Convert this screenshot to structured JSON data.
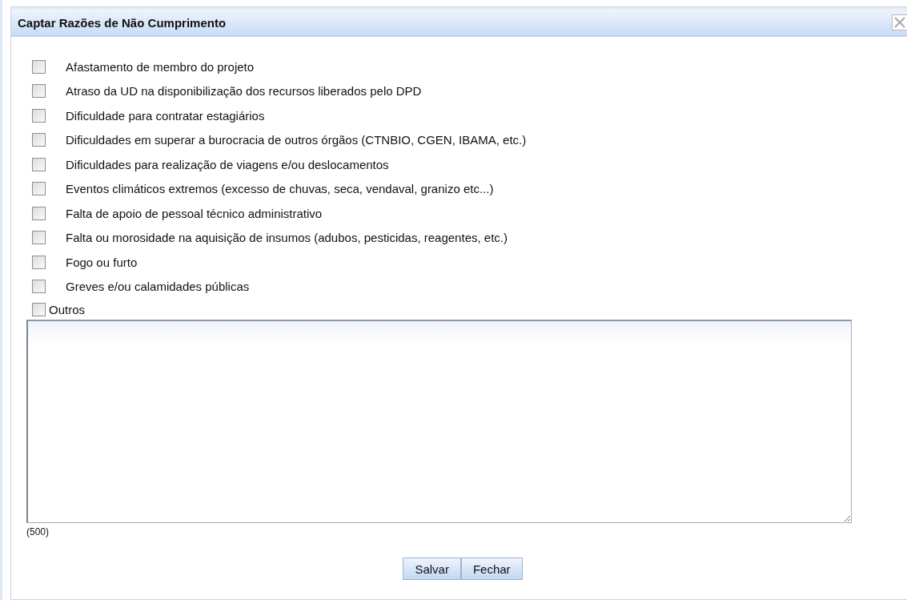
{
  "dialog": {
    "title": "Captar Razões de Não Cumprimento"
  },
  "reasons": [
    {
      "label": "Afastamento de membro do projeto",
      "checked": false
    },
    {
      "label": "Atraso da UD na disponibilização dos recursos liberados pelo DPD",
      "checked": false
    },
    {
      "label": "Dificuldade para contratar estagiários",
      "checked": false
    },
    {
      "label": "Dificuldades em superar a burocracia de outros órgãos (CTNBIO, CGEN, IBAMA, etc.)",
      "checked": false
    },
    {
      "label": "Dificuldades para realização de viagens e/ou deslocamentos",
      "checked": false
    },
    {
      "label": "Eventos climáticos extremos (excesso de chuvas, seca, vendaval, granizo etc...)",
      "checked": false
    },
    {
      "label": "Falta de apoio de pessoal técnico administrativo",
      "checked": false
    },
    {
      "label": "Falta ou morosidade na aquisição de insumos (adubos, pesticidas, reagentes, etc.)",
      "checked": false
    },
    {
      "label": "Fogo ou furto",
      "checked": false
    },
    {
      "label": "Greves e/ou calamidades públicas",
      "checked": false
    }
  ],
  "other": {
    "label": "Outros",
    "checked": false,
    "char_limit": "(500)"
  },
  "buttons": [
    "Salvar",
    "Fechar"
  ]
}
